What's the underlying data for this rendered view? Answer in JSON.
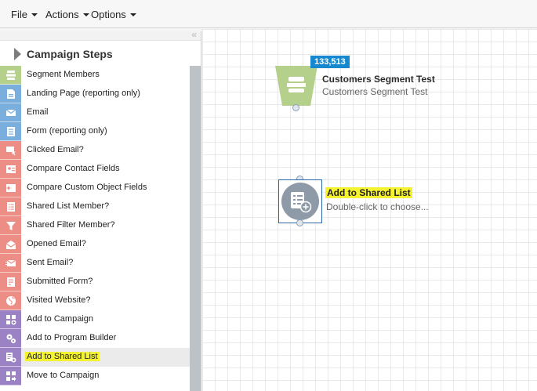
{
  "menubar": {
    "menus": [
      {
        "label": "File"
      },
      {
        "label": "Actions"
      },
      {
        "label": "Options"
      }
    ]
  },
  "panel": {
    "collapse_glyph": "«",
    "title": "Campaign Steps",
    "items": [
      {
        "label": "Segment Members",
        "color": "#b5d08a",
        "icon": "segment-icon"
      },
      {
        "label": "Landing Page (reporting only)",
        "color": "#7aaedc",
        "icon": "landing-page-icon"
      },
      {
        "label": "Email",
        "color": "#7aaedc",
        "icon": "email-icon"
      },
      {
        "label": "Form (reporting only)",
        "color": "#7aaedc",
        "icon": "form-icon"
      },
      {
        "label": "Clicked Email?",
        "color": "#ec8e86",
        "icon": "clicked-email-icon"
      },
      {
        "label": "Compare Contact Fields",
        "color": "#ec8e86",
        "icon": "contact-card-icon"
      },
      {
        "label": "Compare Custom Object Fields",
        "color": "#ec8e86",
        "icon": "custom-object-icon"
      },
      {
        "label": "Shared List Member?",
        "color": "#ec8e86",
        "icon": "list-icon"
      },
      {
        "label": "Shared Filter Member?",
        "color": "#ec8e86",
        "icon": "filter-icon"
      },
      {
        "label": "Opened Email?",
        "color": "#ec8e86",
        "icon": "opened-email-icon"
      },
      {
        "label": "Sent Email?",
        "color": "#ec8e86",
        "icon": "sent-email-icon"
      },
      {
        "label": "Submitted Form?",
        "color": "#ec8e86",
        "icon": "submitted-form-icon"
      },
      {
        "label": "Visited Website?",
        "color": "#ec8e86",
        "icon": "globe-icon"
      },
      {
        "label": "Add to Campaign",
        "color": "#9b82c4",
        "icon": "add-campaign-icon"
      },
      {
        "label": "Add to Program Builder",
        "color": "#9b82c4",
        "icon": "gears-icon"
      },
      {
        "label": "Add to Shared List",
        "color": "#9b82c4",
        "icon": "add-list-icon"
      },
      {
        "label": "Move to Campaign",
        "color": "#9b82c4",
        "icon": "move-campaign-icon"
      }
    ]
  },
  "canvas": {
    "segment_node": {
      "count": "133,513",
      "title": "Customers Segment Test",
      "subtitle": "Customers Segment Test",
      "color": "#b5d08a"
    },
    "list_node": {
      "title": "Add to Shared List",
      "subtitle": "Double-click to choose...",
      "color": "#8e9aa8"
    }
  },
  "colors": {
    "highlight": "#f5f230",
    "badge": "#1588cf",
    "selection_border": "#2b67a8"
  }
}
